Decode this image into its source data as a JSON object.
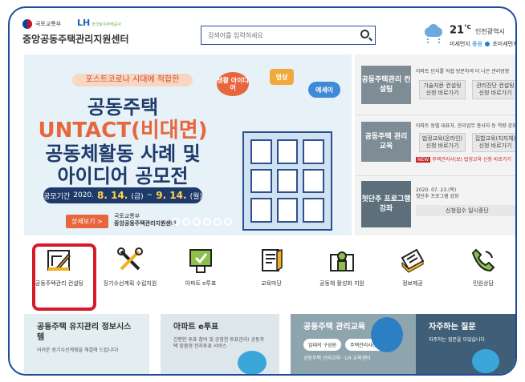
{
  "header": {
    "gov_label": "국토교통부",
    "lh_label": "LH",
    "lh_sub": "한국토지주택공사",
    "site_title": "중앙공동주택관리지원센터",
    "search_placeholder": "검색어를 입력하세요",
    "weather": {
      "temp": "21",
      "unit": "°C",
      "city": "인천광역시",
      "dust_label": "미세먼지",
      "dust_status": "좋음",
      "ultra_dust_label": "초미세먼지"
    }
  },
  "banner": {
    "tag": "포스트코로나 시대에 적합한",
    "line1": "공동주택",
    "line2": "UNTACT(비대면)",
    "line3": "공동체활동 사례 및",
    "line4": "아이디어 공모전",
    "period_label": "공모기간",
    "period_year": "2020.",
    "period_start": "8. 14.",
    "period_start_day": "(금)",
    "period_sep": "~",
    "period_end": "9. 14.",
    "period_end_day": "(월)",
    "detail_button": "상세보기 >",
    "org_gov": "국토교통부",
    "org_name": "중앙공동주택관리지원센터",
    "bubble1": "생활 아이디어",
    "bubble2": "영상",
    "bubble3": "에세이"
  },
  "right_panel": {
    "consulting": {
      "label": "공동주택관리 컨설팅",
      "desc": "아파트 단지를 직접 방문하여 더 나은 관리방향",
      "btn1": "기술자문 컨설팅 신청 바로가기",
      "btn2": "관리진단 컨설팅 신청 바로가기"
    },
    "education": {
      "label": "공동주택 관리 교육",
      "desc": "아파트 동별 대표자, 관리업무 종사자 등 역량 강화",
      "btn1": "법정교육(온라인) 신청 바로가기",
      "btn2": "집합교육(지자체) 신청 바로가기",
      "new_badge": "NEW",
      "new_text": "주택관리사(보) 법정교육 신청 바로가기"
    },
    "program": {
      "label": "첫단추 프로그램 강좌",
      "date": "2020. 07. 23.(목)",
      "desc": "첫단추 프로그램 강좌",
      "btn": "신청접수 일시중단"
    }
  },
  "menu": [
    {
      "label": "공동주택관리 컨설팅",
      "icon": "blueprint-icon"
    },
    {
      "label": "장기수선계획 수립지원",
      "icon": "tools-icon"
    },
    {
      "label": "아파트 e투표",
      "icon": "vote-icon"
    },
    {
      "label": "교육마당",
      "icon": "book-icon"
    },
    {
      "label": "공동체 활성화 지원",
      "icon": "community-icon"
    },
    {
      "label": "정보제공",
      "icon": "newspaper-icon"
    },
    {
      "label": "민원상담",
      "icon": "phone-icon"
    }
  ],
  "cards": {
    "c1": {
      "title": "공동주택 유지관리 정보시스템",
      "desc": "어려운 장기수선계획을 해결해 드립니다!"
    },
    "c2": {
      "title": "아파트 e투표",
      "desc": "간편한 투표 참여 및 공정한 투표관리! 공동주택 맞춤형 전자투표 서비스"
    },
    "c3": {
      "title": "공동주택 관리교육",
      "pill1": "입대의 구성원",
      "pill2": "주택관리사(보)",
      "extra": "공동주택 관리교육 · LH 교육센터"
    },
    "c4": {
      "title": "자주하는 질문",
      "desc": "자주하는 질문을 모았습니다"
    }
  },
  "colors": {
    "frame": "#1f4b99",
    "highlight": "#d61a2a",
    "accent_orange": "#e8663e",
    "navy": "#1e3a6b"
  }
}
